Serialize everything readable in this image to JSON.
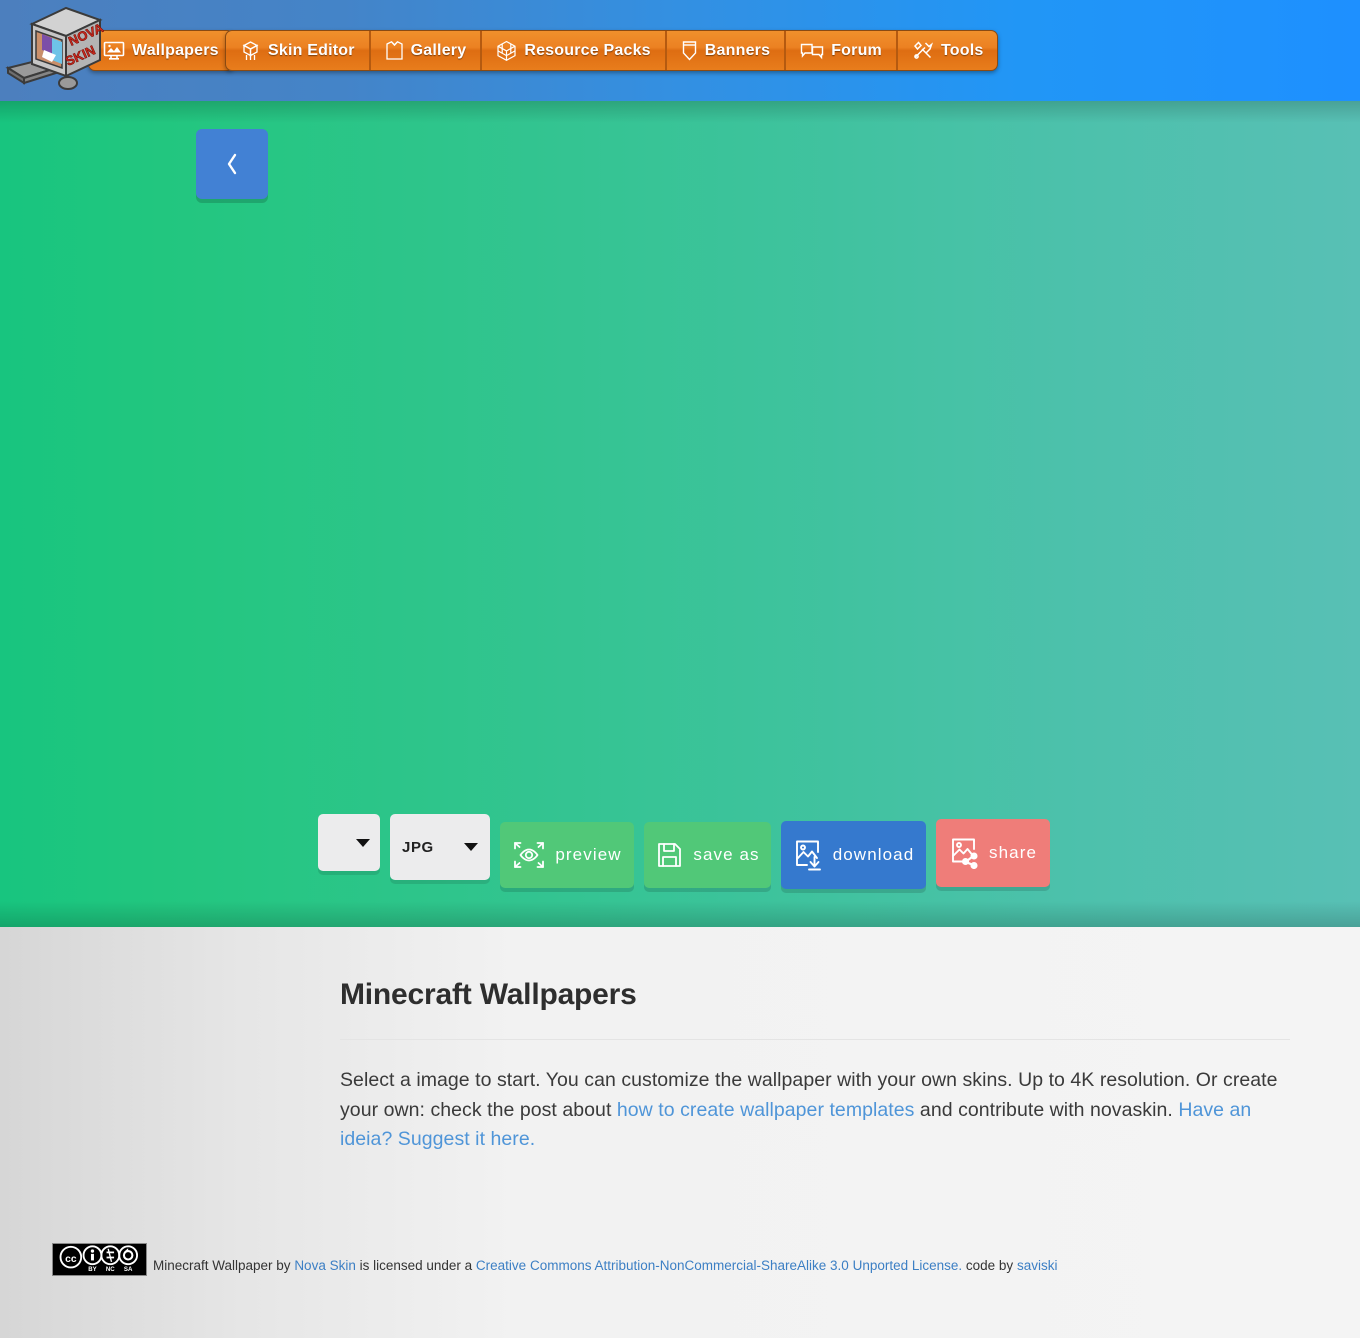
{
  "header": {
    "logo_alt": "nova-skin-logo",
    "primary_nav": [
      {
        "label": "Wallpapers",
        "icon": "monitor-picture-icon",
        "active": true
      }
    ],
    "nav": [
      {
        "label": "Skin Editor",
        "icon": "skin-character-icon"
      },
      {
        "label": "Gallery",
        "icon": "shirt-icon"
      },
      {
        "label": "Resource Packs",
        "icon": "cube-grid-icon"
      },
      {
        "label": "Banners",
        "icon": "banner-shield-icon"
      },
      {
        "label": "Forum",
        "icon": "speech-bubbles-icon"
      },
      {
        "label": "Tools",
        "icon": "wrench-screwdriver-icon"
      }
    ]
  },
  "stage": {
    "prev_button_label": "‹",
    "background_start": "#18c57f",
    "background_end": "#58c0b5"
  },
  "toolbar": {
    "ratio_select_value": "",
    "format_select_value": "JPG",
    "preview_label": "preview",
    "save_as_label": "save as",
    "download_label": "download",
    "share_label": "share",
    "preview_color": "#51c878",
    "save_as_color": "#51c878",
    "download_color": "#3579ce",
    "share_color": "#ef7d79"
  },
  "article": {
    "title": "Minecraft Wallpapers",
    "paragraph": {
      "part1": "Select a image to start. You can customize the wallpaper with your own skins. Up to 4K resolution. Or create your own: check the post about ",
      "link1": "how to create wallpaper templates",
      "part2": " and contribute with novaskin. ",
      "link2": "Have an ideia? Suggest it here."
    }
  },
  "footer": {
    "badge_alt": "creative-commons-by-nc-sa-badge",
    "text1": "Minecraft Wallpaper by ",
    "link_nova_skin": "Nova Skin",
    "text2": " is licensed under a ",
    "link_license": "Creative Commons Attribution-NonCommercial-ShareAlike 3.0 Unported License.",
    "text3": " code by ",
    "link_author": "saviski"
  }
}
